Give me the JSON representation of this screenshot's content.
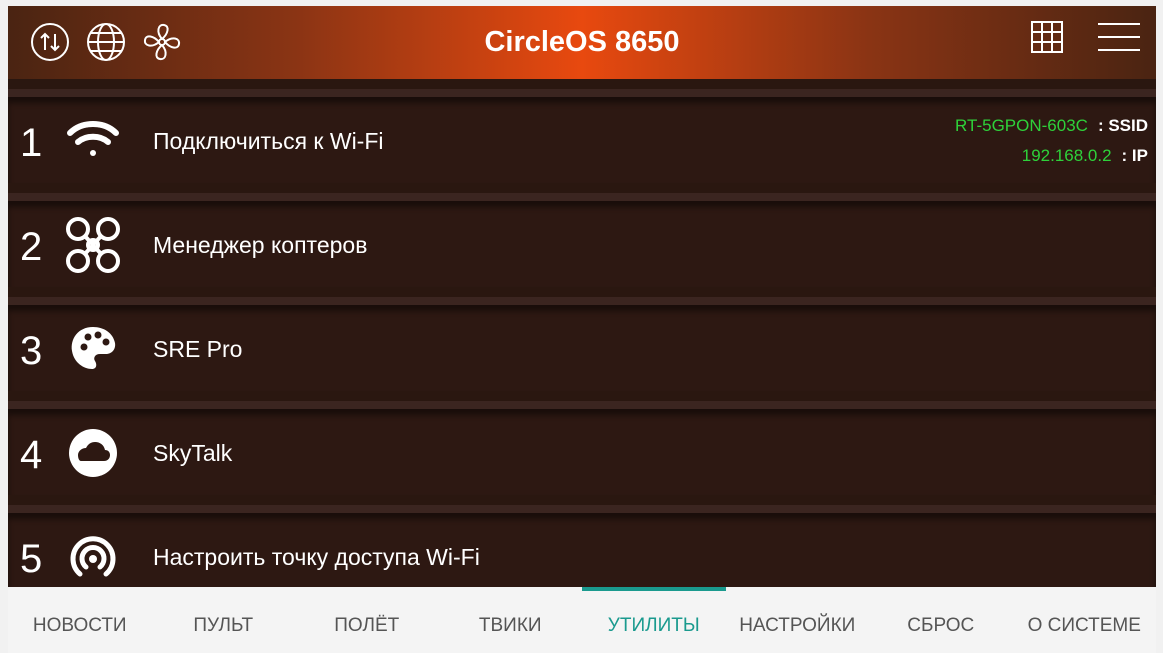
{
  "header": {
    "title": "CircleOS 8650",
    "left_icons": [
      "data-transfer-icon",
      "globe-icon",
      "fan-icon"
    ],
    "right_icons": [
      "grid-icon",
      "menu-icon"
    ]
  },
  "items": [
    {
      "num": "1",
      "label": "Подключиться к Wi-Fi",
      "icon": "wifi-icon"
    },
    {
      "num": "2",
      "label": "Менеджер коптеров",
      "icon": "drone-icon"
    },
    {
      "num": "3",
      "label": "SRE Pro",
      "icon": "palette-icon"
    },
    {
      "num": "4",
      "label": "SkyTalk",
      "icon": "cloud-icon"
    },
    {
      "num": "5",
      "label": "Настроить точку доступа Wi-Fi",
      "icon": "hotspot-icon"
    }
  ],
  "status": {
    "ssid_value": "RT-5GPON-603C",
    "ssid_label": ": SSID",
    "ip_value": "192.168.0.2",
    "ip_label": ": IP"
  },
  "tabs": [
    {
      "label": "НОВОСТИ",
      "active": false
    },
    {
      "label": "ПУЛЬТ",
      "active": false
    },
    {
      "label": "ПОЛЁТ",
      "active": false
    },
    {
      "label": "ТВИКИ",
      "active": false
    },
    {
      "label": "УТИЛИТЫ",
      "active": true
    },
    {
      "label": "НАСТРОЙКИ",
      "active": false
    },
    {
      "label": "СБРОС",
      "active": false
    },
    {
      "label": "О СИСТЕМЕ",
      "active": false
    }
  ],
  "colors": {
    "accent": "#1a9a8e",
    "status_green": "#2ed13a",
    "header_center": "#e8490f"
  }
}
